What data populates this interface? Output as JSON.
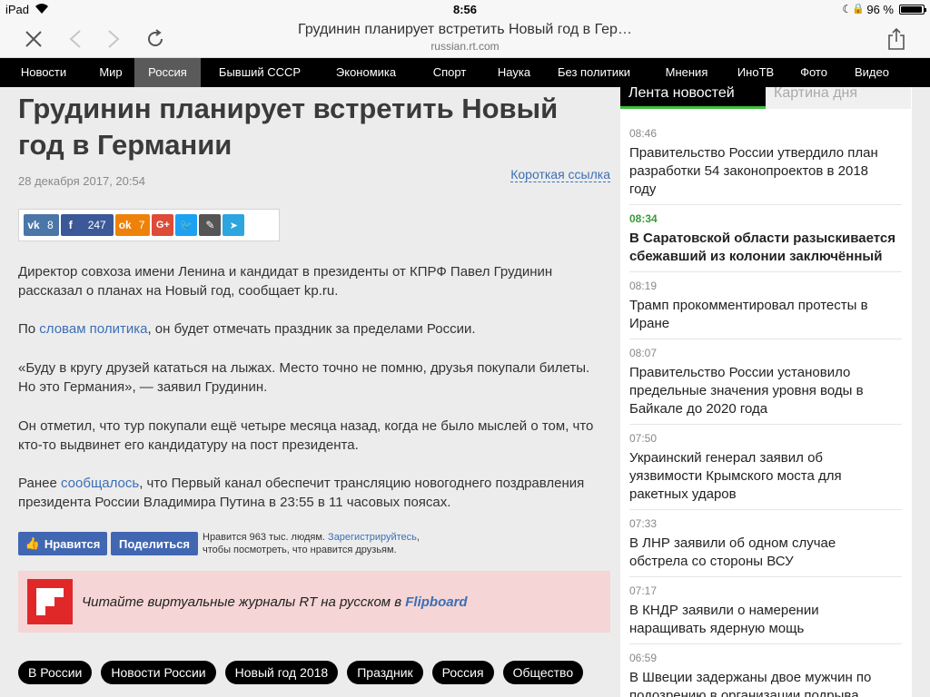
{
  "status_bar": {
    "device": "iPad",
    "time": "8:56",
    "battery": "96 %"
  },
  "browser": {
    "page_title": "Грудинин планирует встретить Новый год в Гер…",
    "host": "russian.rt.com",
    "icons": [
      "close-icon",
      "back-icon",
      "forward-icon",
      "reload-icon",
      "share-icon"
    ]
  },
  "menu": {
    "items": [
      "Новости",
      "Мир",
      "Россия",
      "Бывший СССР",
      "Экономика",
      "Спорт",
      "Наука",
      "Без политики",
      "Мнения",
      "ИноТВ",
      "Фото",
      "Видео"
    ],
    "active": "Россия"
  },
  "article": {
    "headline": "Грудинин планирует встретить Новый год в Германии",
    "date": "28 декабря 2017, 20:54",
    "short_link": "Короткая ссылка",
    "share": {
      "vk": "8",
      "fb": "247",
      "ok": "7"
    },
    "p1": "Директор совхоза имени Ленина и кандидат в президенты от КПРФ Павел Грудинин рассказал о планах на Новый год, сообщает kp.ru.",
    "p2_pre": "По ",
    "p2_link": "словам политика",
    "p2_post": ", он будет отмечать праздник за пределами России.",
    "p3": "«Буду в кругу друзей кататься на лыжах. Место точно не помню, друзья покупали билеты. Но это Германия», — заявил Грудинин.",
    "p4": "Он отметил, что тур покупали ещё четыре месяца назад, когда не было мыслей о том, что кто-то выдвинет его кандидатуру на пост президента.",
    "p5_pre": "Ранее ",
    "p5_link": "сообщалось",
    "p5_post": ", что Первый канал обеспечит трансляцию новогоднего поздравления президента России Владимира Путина в 23:55 в 11 часовых поясах."
  },
  "facebook": {
    "like": "Нравится",
    "share": "Поделиться",
    "text_pre": "Нравится 963 тыс. людям. ",
    "text_link": "Зарегистрируйтесь",
    "text_post": ", чтобы посмотреть, что нравится друзьям."
  },
  "flipboard": {
    "text": "Читайте виртуальные журналы RT на русском в ",
    "brand": "Flipboard"
  },
  "tags": [
    "В России",
    "Новости России",
    "Новый год 2018",
    "Праздник",
    "Россия",
    "Общество"
  ],
  "sidebar": {
    "tabs": [
      "Лента новостей",
      "Картина дня"
    ],
    "news": [
      {
        "time": "08:46",
        "title": "Правительство России утвердило план разработки 54 законопроектов в 2018 году"
      },
      {
        "time": "08:34",
        "title": "В Саратовской области разыскивается сбежавший из колонии заключённый"
      },
      {
        "time": "08:19",
        "title": "Трамп прокомментировал протесты в Иране"
      },
      {
        "time": "08:07",
        "title": "Правительство России установило предельные значения уровня воды в Байкале до 2020 года"
      },
      {
        "time": "07:50",
        "title": "Украинский генерал заявил об уязвимости Крымского моста для ракетных ударов"
      },
      {
        "time": "07:33",
        "title": "В ЛНР заявили об одном случае обстрела со стороны ВСУ"
      },
      {
        "time": "07:17",
        "title": "В КНДР заявили о намерении наращивать ядерную мощь"
      },
      {
        "time": "06:59",
        "title": "В Швеции задержаны двое мужчин по подозрению в организации подрыва"
      }
    ]
  }
}
